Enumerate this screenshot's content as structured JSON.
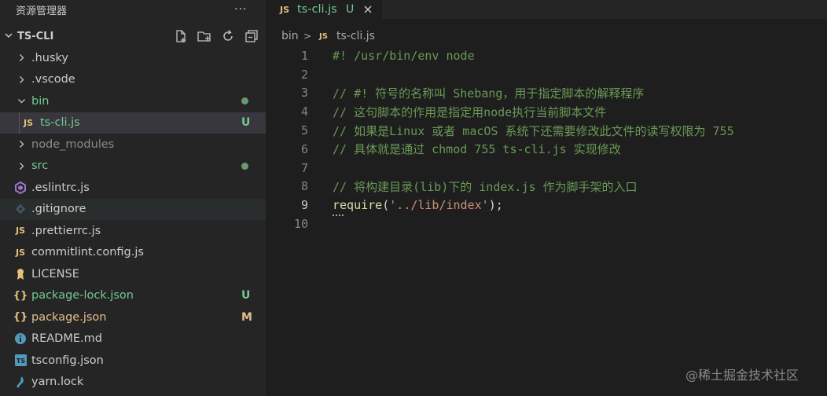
{
  "explorer": {
    "title": "资源管理器",
    "more_label": "···",
    "project_name": "TS-CLI"
  },
  "tree": [
    {
      "label": ".husky",
      "type": "folder",
      "expanded": false
    },
    {
      "label": ".vscode",
      "type": "folder",
      "expanded": false
    },
    {
      "label": "bin",
      "type": "folder",
      "expanded": true,
      "dot": true
    },
    {
      "label": "ts-cli.js",
      "type": "js",
      "badge": "U",
      "selected": true
    },
    {
      "label": "node_modules",
      "type": "folder",
      "expanded": false
    },
    {
      "label": "src",
      "type": "folder",
      "expanded": false,
      "dot": true
    },
    {
      "label": ".eslintrc.js",
      "type": "eslint"
    },
    {
      "label": ".gitignore",
      "type": "git",
      "hover": true
    },
    {
      "label": ".prettierrc.js",
      "type": "js"
    },
    {
      "label": "commitlint.config.js",
      "type": "js"
    },
    {
      "label": "LICENSE",
      "type": "license"
    },
    {
      "label": "package-lock.json",
      "type": "json",
      "badge": "U"
    },
    {
      "label": "package.json",
      "type": "json",
      "badge": "M"
    },
    {
      "label": "README.md",
      "type": "info"
    },
    {
      "label": "tsconfig.json",
      "type": "ts"
    },
    {
      "label": "yarn.lock",
      "type": "yarn"
    }
  ],
  "icons": {
    "js": "JS",
    "json": "{}",
    "ts": "TS"
  },
  "tab": {
    "label": "ts-cli.js",
    "status": "U"
  },
  "breadcrumb": {
    "folder": "bin",
    "separator": ">",
    "file": "ts-cli.js"
  },
  "code": [
    {
      "n": "1",
      "text": "#! /usr/bin/env node"
    },
    {
      "n": "2",
      "text": ""
    },
    {
      "n": "3",
      "text": "// #! 符号的名称叫 Shebang，用于指定脚本的解释程序"
    },
    {
      "n": "4",
      "text": "// 这句脚本的作用是指定用node执行当前脚本文件"
    },
    {
      "n": "5",
      "text": "// 如果是Linux 或者 macOS 系统下还需要修改此文件的读写权限为 755"
    },
    {
      "n": "6",
      "text": "// 具体就是通过 chmod 755 ts-cli.js 实现修改"
    },
    {
      "n": "7",
      "text": ""
    },
    {
      "n": "8",
      "text": "// 将构建目录(lib)下的 index.js 作为脚手架的入口"
    },
    {
      "n": "9",
      "fn": "require",
      "open": "(",
      "str": "'../lib/index'",
      "close": ");"
    },
    {
      "n": "10",
      "text": ""
    }
  ],
  "watermark": "@稀土掘金技术社区",
  "colors": {
    "untracked": "#73c991",
    "modified": "#e2c08d",
    "comment": "#6a9955",
    "string": "#ce9178",
    "function": "#dcdcaa"
  }
}
